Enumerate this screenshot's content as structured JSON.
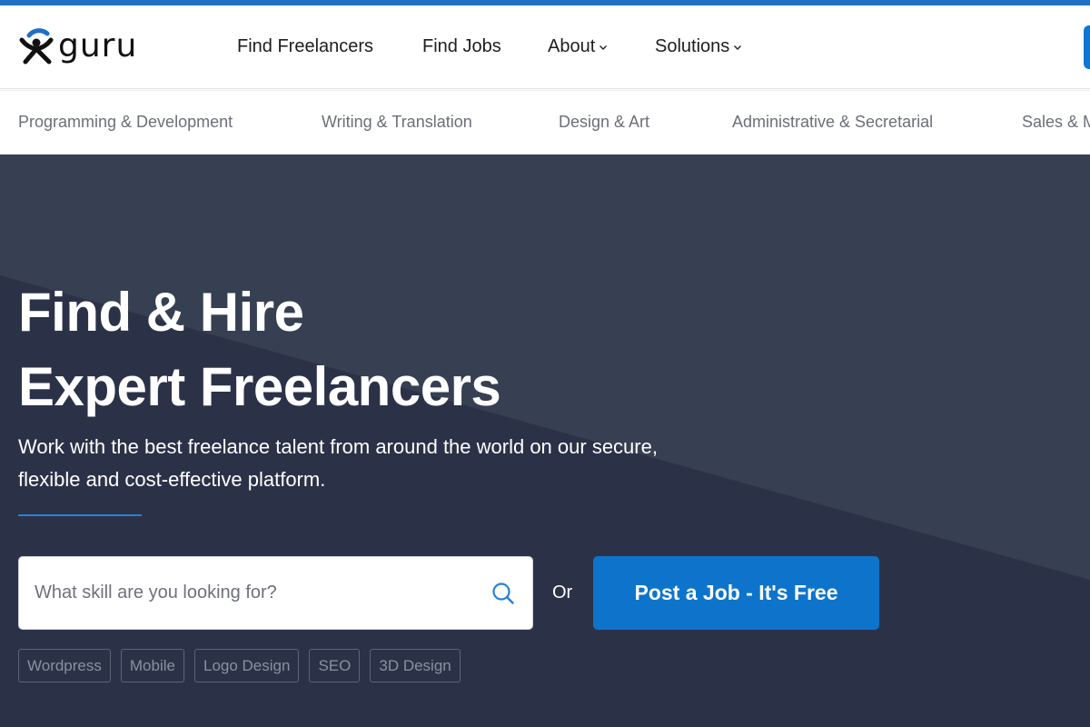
{
  "brand": {
    "name": "guru",
    "accent_color": "#1f6fc4",
    "button_color": "#0e74cb"
  },
  "header": {
    "nav": [
      {
        "label": "Find Freelancers",
        "has_dropdown": false
      },
      {
        "label": "Find Jobs",
        "has_dropdown": false
      },
      {
        "label": "About",
        "has_dropdown": true
      },
      {
        "label": "Solutions",
        "has_dropdown": true
      }
    ]
  },
  "categories": [
    "Programming & Development",
    "Writing & Translation",
    "Design & Art",
    "Administrative & Secretarial",
    "Sales & Marketing"
  ],
  "hero": {
    "title_line1": "Find & Hire",
    "title_line2": "Expert Freelancers",
    "subtitle_line1": "Work with the best freelance talent from around the world on our secure,",
    "subtitle_line2": "flexible and cost-effective platform.",
    "search": {
      "placeholder": "What skill are you looking for?",
      "value": ""
    },
    "or_label": "Or",
    "post_job_label": "Post a Job - It's Free",
    "tags": [
      "Wordpress",
      "Mobile",
      "Logo Design",
      "SEO",
      "3D Design"
    ]
  }
}
